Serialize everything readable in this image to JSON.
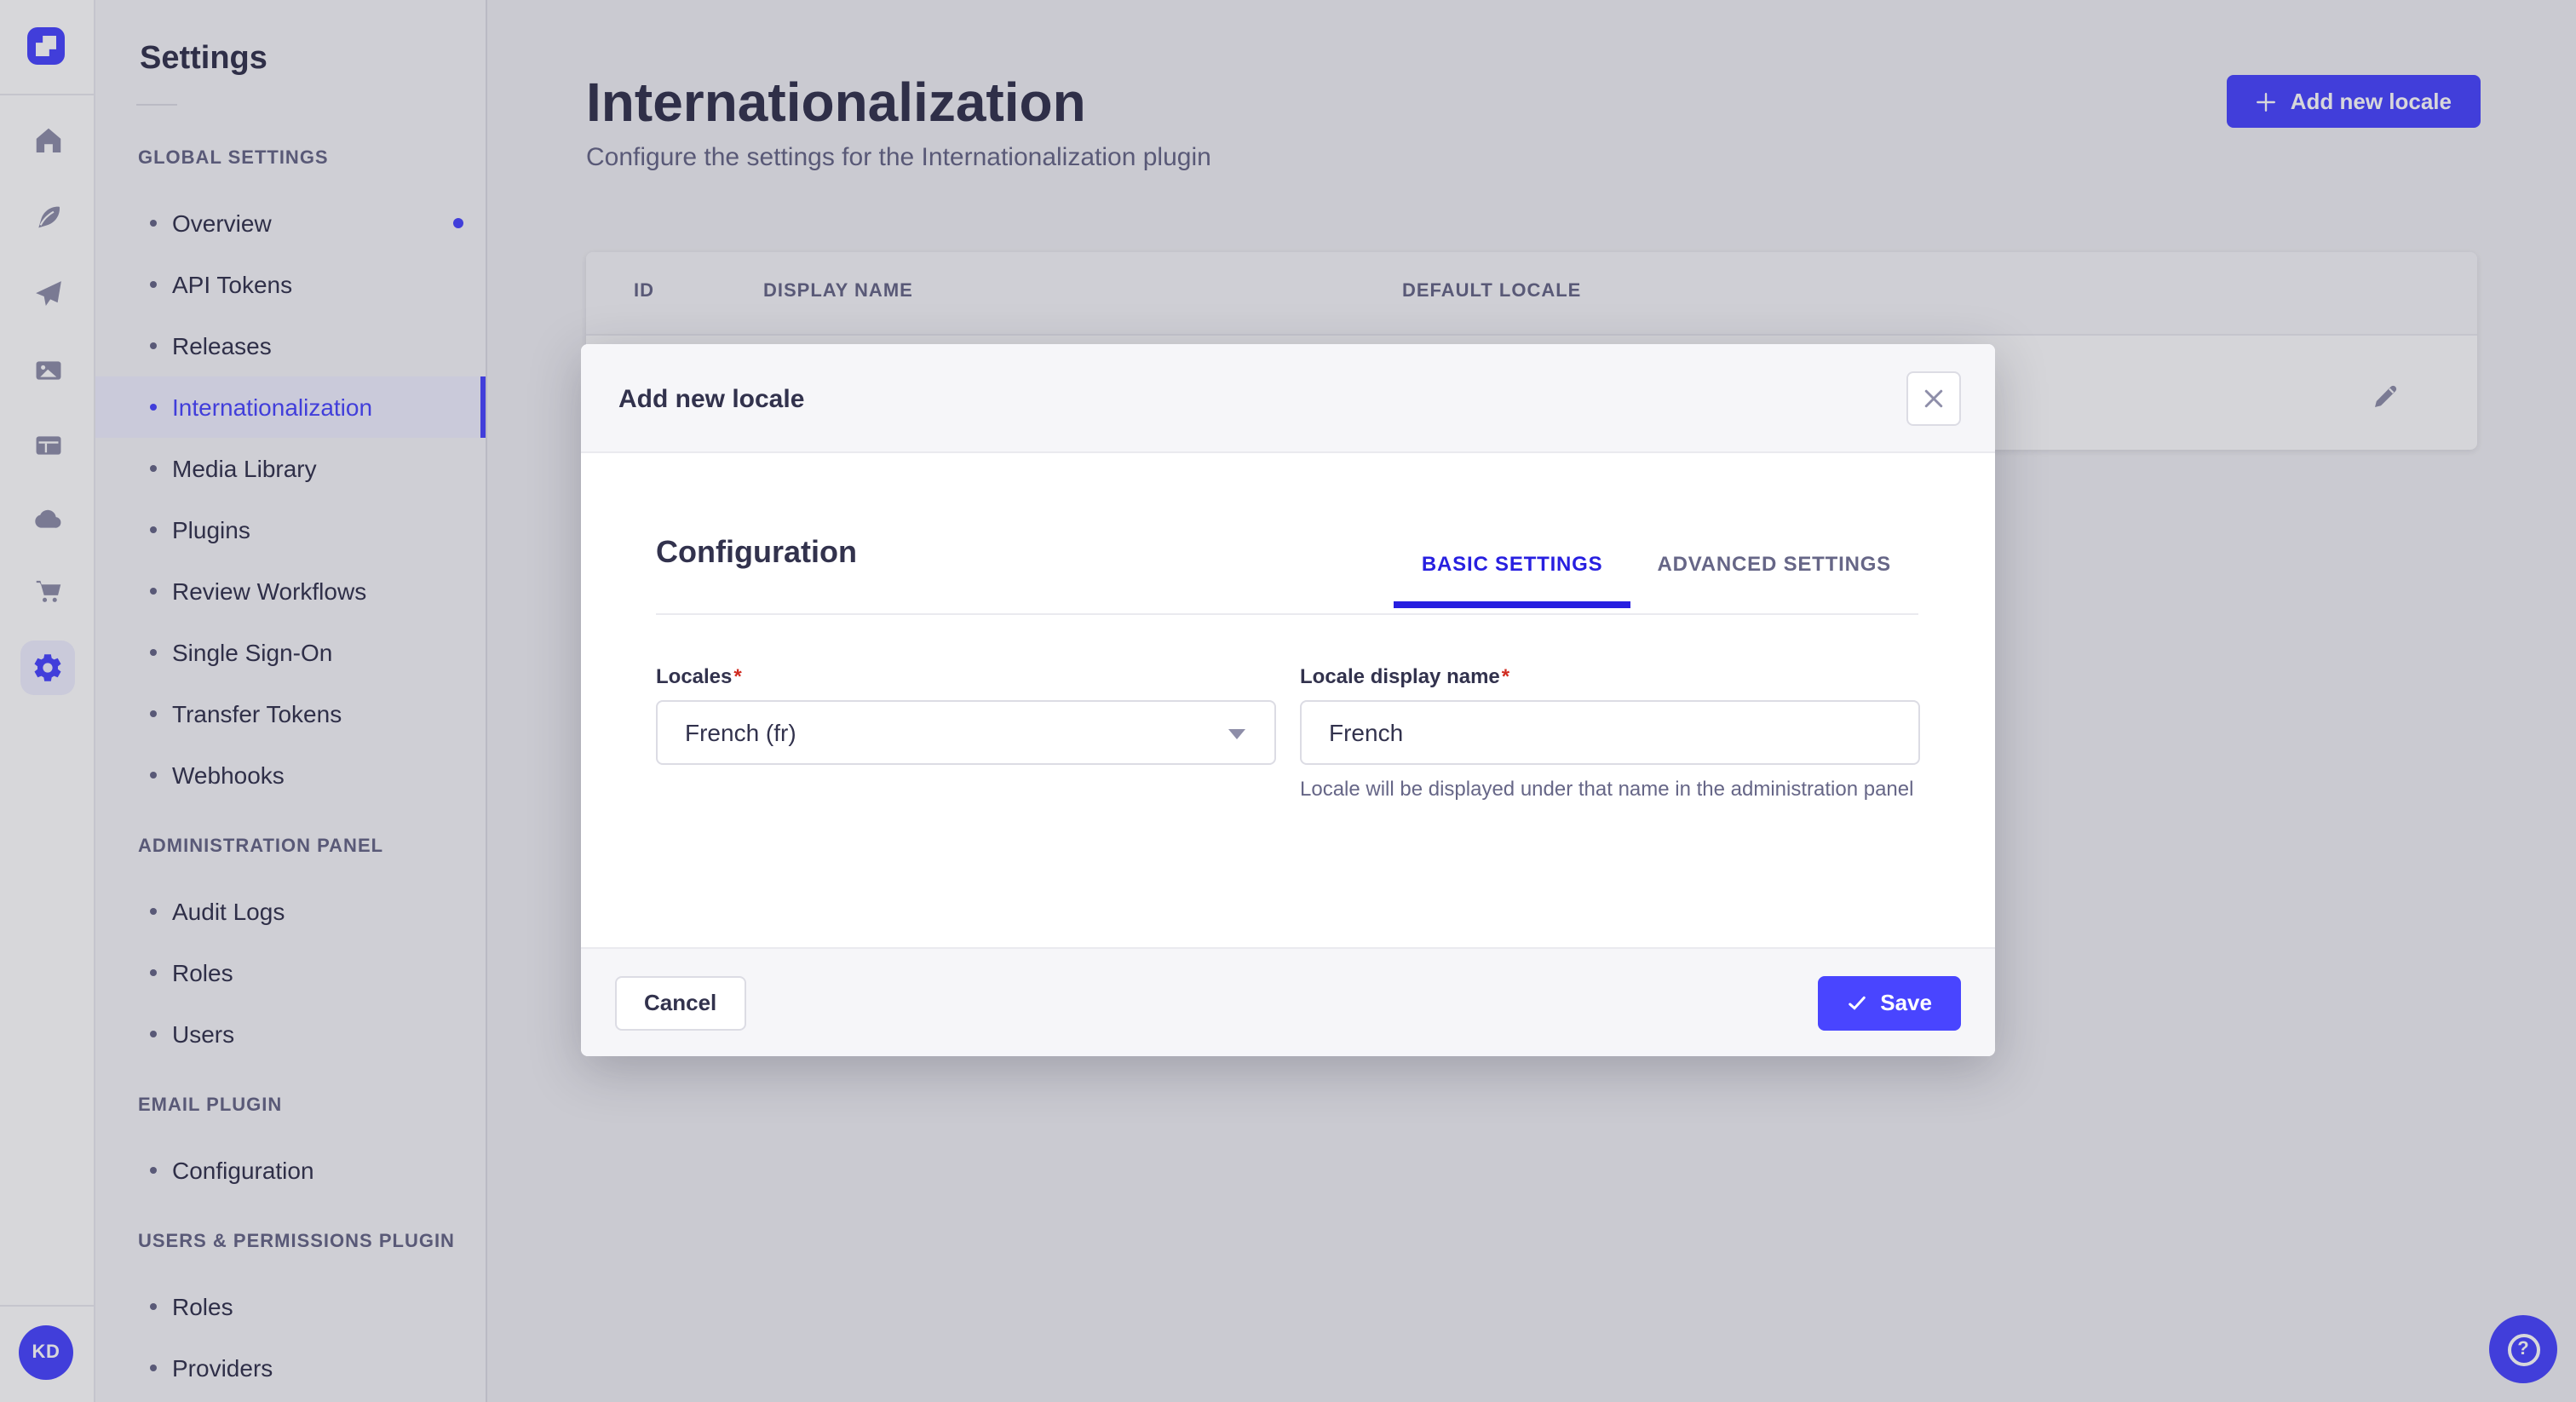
{
  "colors": {
    "accent": "#4945FF",
    "tab_active": "#271FE0",
    "required_asterisk": "#D02B20"
  },
  "rail": {
    "avatar_initials": "KD",
    "icons": [
      "strapi-logo",
      "home",
      "content-manager",
      "releases",
      "media-library",
      "content-type-builder",
      "deploy",
      "marketplace",
      "settings"
    ]
  },
  "sidebar": {
    "title": "Settings",
    "sections": [
      {
        "title": "GLOBAL SETTINGS",
        "items": [
          {
            "label": "Overview",
            "notification": true
          },
          {
            "label": "API Tokens"
          },
          {
            "label": "Releases"
          },
          {
            "label": "Internationalization",
            "active": true
          },
          {
            "label": "Media Library"
          },
          {
            "label": "Plugins"
          },
          {
            "label": "Review Workflows"
          },
          {
            "label": "Single Sign-On"
          },
          {
            "label": "Transfer Tokens"
          },
          {
            "label": "Webhooks"
          }
        ]
      },
      {
        "title": "ADMINISTRATION PANEL",
        "items": [
          {
            "label": "Audit Logs"
          },
          {
            "label": "Roles"
          },
          {
            "label": "Users"
          }
        ]
      },
      {
        "title": "EMAIL PLUGIN",
        "items": [
          {
            "label": "Configuration"
          }
        ]
      },
      {
        "title": "USERS & PERMISSIONS PLUGIN",
        "items": [
          {
            "label": "Roles"
          },
          {
            "label": "Providers"
          }
        ]
      }
    ]
  },
  "main": {
    "title": "Internationalization",
    "subtitle": "Configure the settings for the Internationalization plugin",
    "add_button_label": "Add new locale",
    "table": {
      "columns": [
        "ID",
        "DISPLAY NAME",
        "DEFAULT LOCALE"
      ]
    }
  },
  "modal": {
    "title": "Add new locale",
    "section_title": "Configuration",
    "tabs": [
      {
        "label": "BASIC SETTINGS",
        "active": true
      },
      {
        "label": "ADVANCED SETTINGS",
        "active": false
      }
    ],
    "fields": {
      "locales": {
        "label": "Locales",
        "required": "*",
        "value": "French (fr)"
      },
      "display_name": {
        "label": "Locale display name",
        "required": "*",
        "value": "French",
        "hint": "Locale will be displayed under that name in the administration panel"
      }
    },
    "cancel_label": "Cancel",
    "save_label": "Save"
  }
}
